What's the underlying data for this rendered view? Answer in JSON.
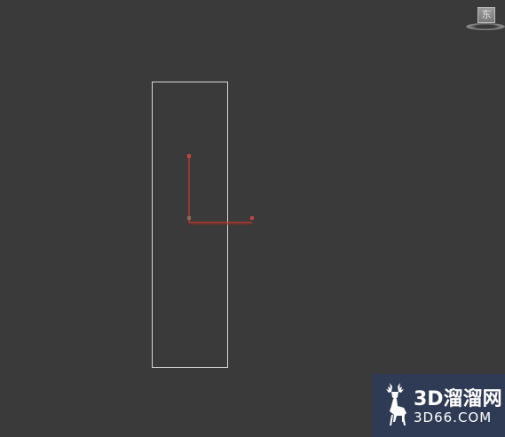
{
  "viewcube": {
    "face_label": "东"
  },
  "watermark": {
    "brand": "3D溜溜网",
    "url": "3D66.COM"
  },
  "colors": {
    "background": "#3a3a3a",
    "selection_rect": "#d8d8d8",
    "gizmo": "#b33a2e",
    "watermark_bg": "#2f3b55"
  },
  "icons": {
    "viewcube": "viewcube-icon",
    "transform_gizmo": "move-gizmo-icon",
    "logo": "deer-logo-icon"
  }
}
